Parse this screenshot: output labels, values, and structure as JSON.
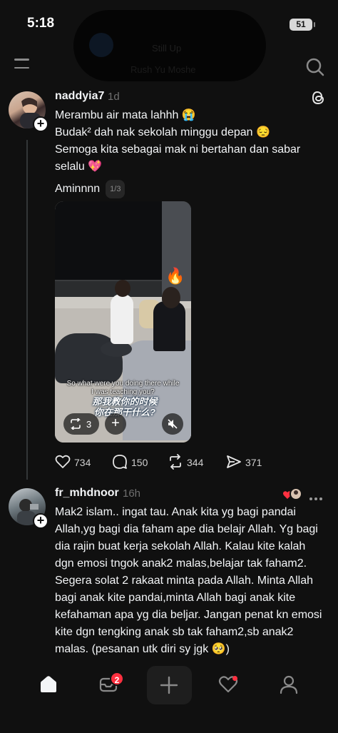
{
  "status_bar": {
    "time": "5:18",
    "battery": "51",
    "island_line1": "Still Up",
    "island_line2": "Rush Yu Moshe"
  },
  "top_nav": {
    "menu_icon": "hamburger-menu-icon",
    "search_icon": "search-icon"
  },
  "posts": [
    {
      "username": "naddyia7",
      "time": "1d",
      "lines": [
        "Merambu air mata lahhh 😭",
        "Budak² dah nak sekolah minggu depan 😔",
        "Semoga kita sebagai mak ni bertahan dan sabar",
        "selalu 💖"
      ],
      "last_line": "Aminnnn",
      "page_indicator": "1/3",
      "media": {
        "subtitle_en": "So what were you doing there while I was teaching you?",
        "subtitle_small": "So what were you doing there while",
        "subtitle_small2": "I was teaching you?",
        "subtitle_zh1": "那我教你的时候",
        "subtitle_zh2": "你在那干什么?",
        "repost_count": "3"
      },
      "stats": {
        "likes": "734",
        "replies": "150",
        "reposts": "344",
        "shares": "371"
      }
    },
    {
      "username": "fr_mhdnoor",
      "time": "16h",
      "lines": [
        "Mak2 islam.. ingat tau. Anak kita yg bagi pandai",
        "Allah,yg bagi dia faham ape dia belajr Allah. Yg bagi",
        "dia rajin buat kerja sekolah Allah. Kalau kite kalah",
        "dgn emosi tngok anak2 malas,belajar tak faham2.",
        "Segera solat 2 rakaat minta pada Allah. Minta Allah",
        "bagi anak kite pandai,minta Allah bagi anak kite",
        "kefahaman apa yg dia beljar. Jangan penat kn emosi",
        "kite dgn tengking anak sb tak faham2,sb anak2",
        "malas. (pesanan utk diri sy jgk 🥺)"
      ]
    }
  ],
  "tab_bar": {
    "inbox_badge": "2",
    "tabs": [
      "home-icon",
      "inbox-icon",
      "compose-icon",
      "activity-icon",
      "profile-icon"
    ]
  },
  "colors": {
    "background": "#101010",
    "text": "#f3f5f7",
    "muted": "#6f6f6f",
    "notification": "#ff3040"
  }
}
